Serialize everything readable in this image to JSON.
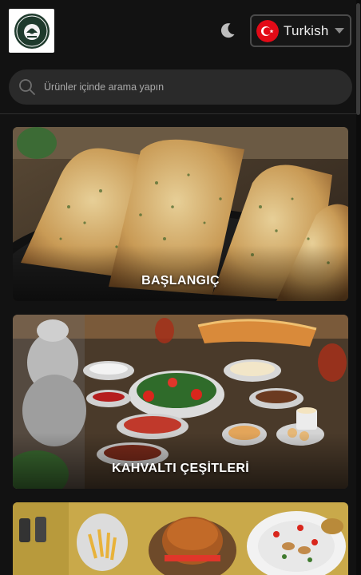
{
  "header": {
    "logo_text": "HÜRA CAFE",
    "language": {
      "label": "Turkish",
      "flag": "turkey-flag-icon"
    },
    "theme_toggle_icon": "moon-icon"
  },
  "search": {
    "placeholder": "Ürünler içinde arama yapın",
    "value": "",
    "icon": "search-icon"
  },
  "categories": [
    {
      "title": "BAŞLANGIÇ"
    },
    {
      "title": "KAHVALTI ÇEŞİTLERİ"
    },
    {
      "title": ""
    }
  ],
  "colors": {
    "background": "#121212",
    "search_bg": "#2a2a2a",
    "flag_red": "#e30a17",
    "text": "#ffffff"
  }
}
